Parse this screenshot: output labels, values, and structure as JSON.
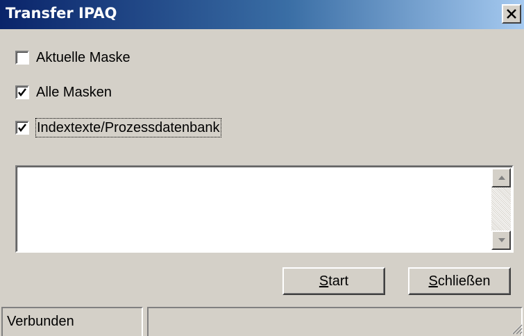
{
  "window": {
    "title": "Transfer IPAQ"
  },
  "options": [
    {
      "label": "Aktuelle Maske",
      "checked": false
    },
    {
      "label": "Alle Masken",
      "checked": true
    },
    {
      "label": "Indextexte/Prozessdatenbank",
      "checked": true
    }
  ],
  "buttons": {
    "start": {
      "mnemonic": "S",
      "rest": "tart"
    },
    "close": {
      "mnemonic": "S",
      "rest": "chließen"
    }
  },
  "status": {
    "text": "Verbunden",
    "second": ""
  },
  "colors": {
    "titlebar_start": "#0a246a",
    "titlebar_end": "#a6caf0",
    "face": "#d4d0c8"
  }
}
